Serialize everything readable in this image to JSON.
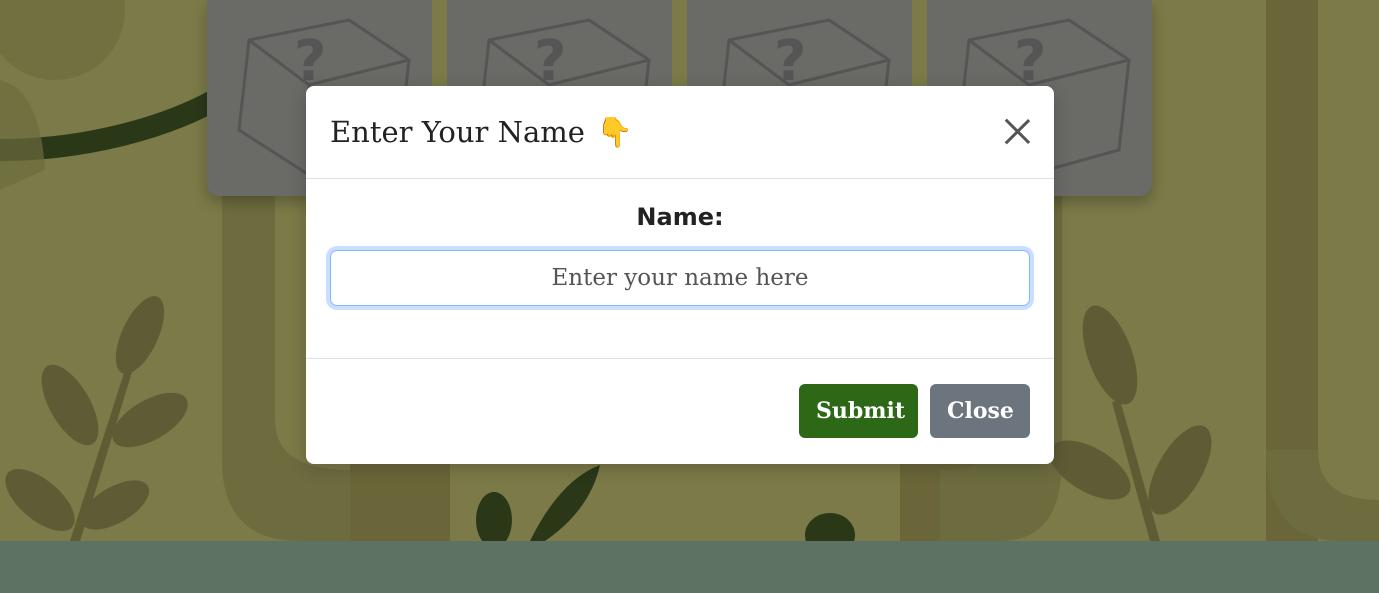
{
  "modal": {
    "title": "Enter Your Name",
    "title_emoji": "👇",
    "close_icon": "close-icon",
    "field_label": "Name:",
    "input_value": "",
    "input_placeholder": "Enter your name here",
    "submit_label": "Submit",
    "close_label": "Close"
  },
  "cards": [
    {
      "icon": "mystery-box-icon",
      "glyph": "?"
    },
    {
      "icon": "mystery-box-icon",
      "glyph": "?"
    },
    {
      "icon": "mystery-box-icon",
      "glyph": "?"
    },
    {
      "icon": "mystery-box-icon",
      "glyph": "?"
    }
  ],
  "colors": {
    "background": "#7b7a48",
    "ground": "#5d7263",
    "card": "#6a6a66",
    "submit": "#2d6816",
    "close": "#6c757d"
  }
}
